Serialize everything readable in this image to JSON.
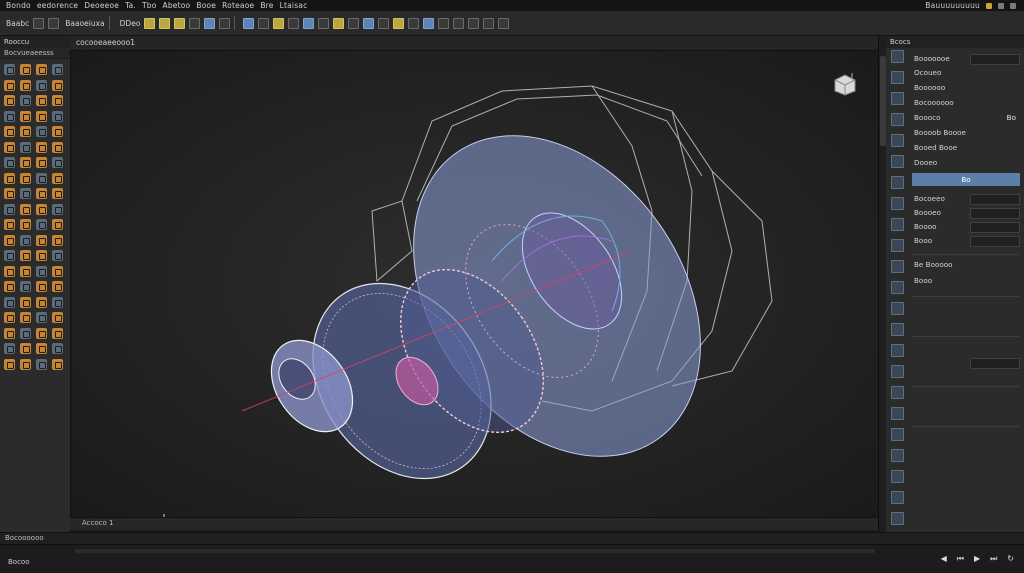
{
  "menu": {
    "items": [
      "Bondo",
      "eedorence",
      "Deoeeoe",
      "Ta.",
      "Tbo",
      "Abetoo",
      "Booe",
      "Roteaoe",
      "Bre",
      "Ltaisac"
    ],
    "right_text": "Bauuuuuuuuu"
  },
  "toolbar": {
    "left_label": "Baabc",
    "groups": [
      "Baaoeiuxa",
      "DDeo"
    ]
  },
  "left_panel": {
    "title": "Rooccu",
    "subtitle": "Bocvueaeesss"
  },
  "viewport": {
    "tab_label": "cocooeaeeooo1",
    "status_text": "Accoco 1"
  },
  "right_panel": {
    "title": "Bcocs",
    "rows": [
      {
        "label": "Booooooe",
        "value": ""
      },
      {
        "label": "Ocoueo",
        "value": ""
      },
      {
        "label": "Boooooo",
        "value": ""
      },
      {
        "label": "Bocoooooo",
        "value": ""
      },
      {
        "label": "Boooco",
        "value": "Bo"
      },
      {
        "label": "Boooob Boooe",
        "value": ""
      },
      {
        "label": "Booed Booe",
        "value": ""
      },
      {
        "label": "Dooeo",
        "value": ""
      },
      {
        "label": "Bo",
        "value": ""
      },
      {
        "label": "Bocoeeo",
        "value": ""
      },
      {
        "label": "Boooeo",
        "value": ""
      },
      {
        "label": "Boooo",
        "value": ""
      },
      {
        "label": "Booo",
        "value": ""
      },
      {
        "label": "Be Booooo",
        "value": ""
      },
      {
        "label": "Booo",
        "value": ""
      }
    ],
    "selected_value": "Bo"
  },
  "bottom": {
    "status": "Bocoooooo",
    "info": "Bocoo"
  },
  "colors": {
    "accent_blue": "#5a7fa9",
    "orange": "#c78531",
    "mesh_blue": "#8fa0d8",
    "mesh_pink": "#c9a0b0"
  }
}
